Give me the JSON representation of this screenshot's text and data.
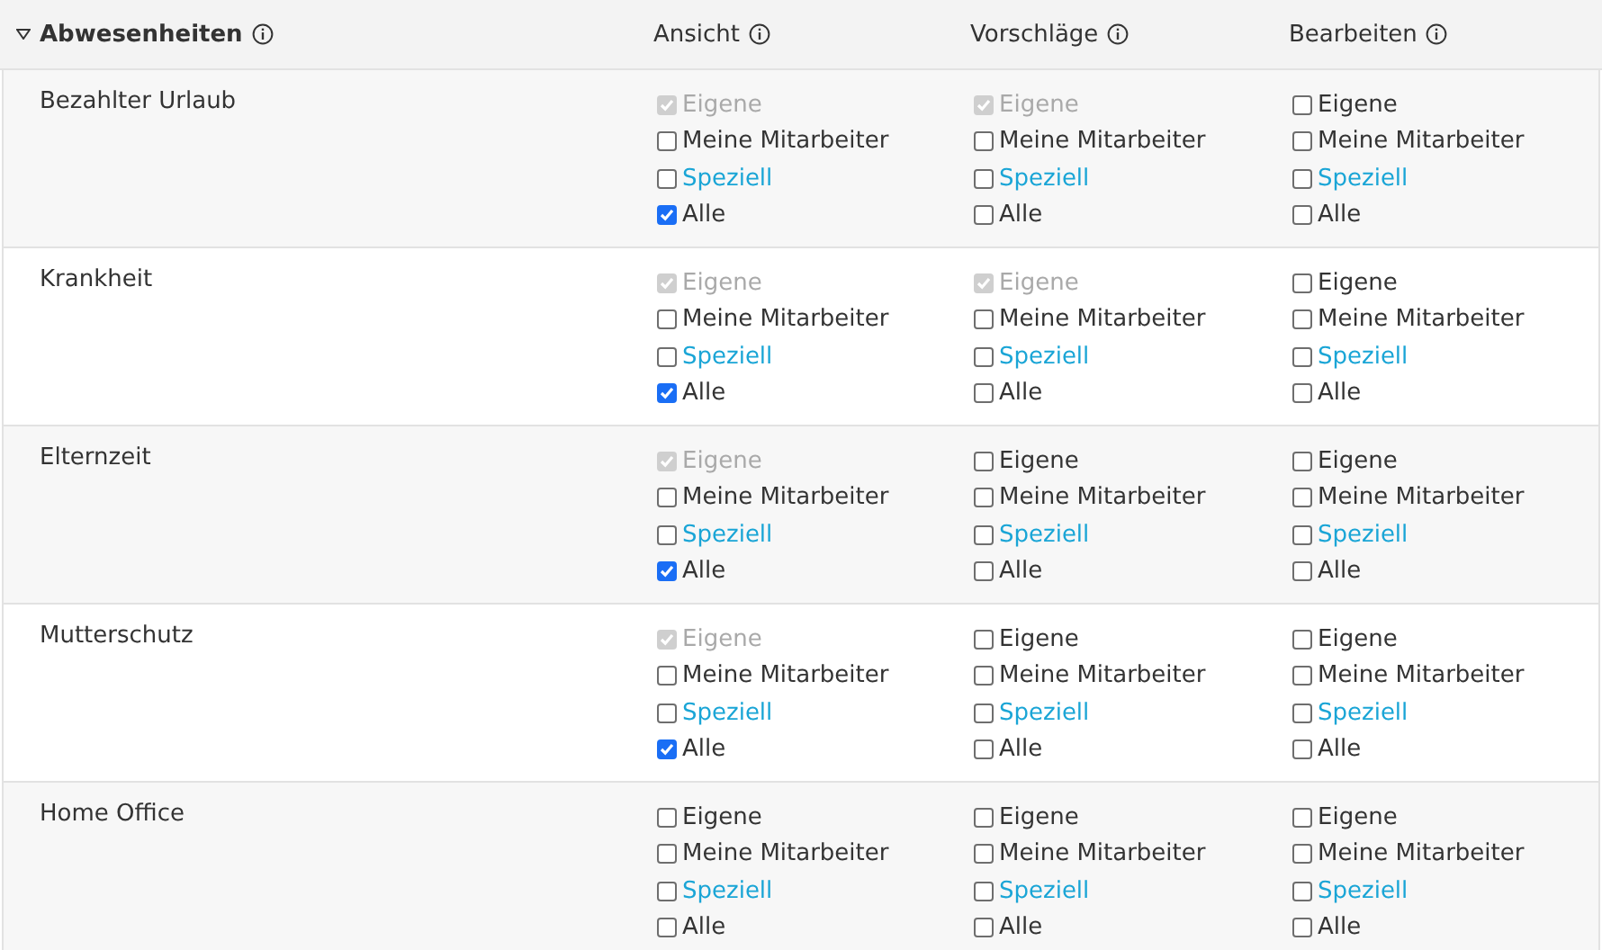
{
  "section": {
    "title": "Abwesenheiten",
    "expanded": true
  },
  "columns": [
    {
      "label": "Ansicht"
    },
    {
      "label": "Vorschläge"
    },
    {
      "label": "Bearbeiten"
    }
  ],
  "rows": [
    {
      "name": "Bezahlter Urlaub",
      "groups": [
        [
          {
            "label": "Eigene",
            "kind": "text",
            "checked": true,
            "disabled": true
          },
          {
            "label": "Meine Mitarbeiter",
            "kind": "text",
            "checked": false,
            "disabled": false
          },
          {
            "label": "Speziell",
            "kind": "link",
            "checked": false,
            "disabled": false
          },
          {
            "label": "Alle",
            "kind": "text",
            "checked": true,
            "disabled": false
          }
        ],
        [
          {
            "label": "Eigene",
            "kind": "text",
            "checked": true,
            "disabled": true
          },
          {
            "label": "Meine Mitarbeiter",
            "kind": "text",
            "checked": false,
            "disabled": false
          },
          {
            "label": "Speziell",
            "kind": "link",
            "checked": false,
            "disabled": false
          },
          {
            "label": "Alle",
            "kind": "text",
            "checked": false,
            "disabled": false
          }
        ],
        [
          {
            "label": "Eigene",
            "kind": "text",
            "checked": false,
            "disabled": false
          },
          {
            "label": "Meine Mitarbeiter",
            "kind": "text",
            "checked": false,
            "disabled": false
          },
          {
            "label": "Speziell",
            "kind": "link",
            "checked": false,
            "disabled": false
          },
          {
            "label": "Alle",
            "kind": "text",
            "checked": false,
            "disabled": false
          }
        ]
      ]
    },
    {
      "name": "Krankheit",
      "groups": [
        [
          {
            "label": "Eigene",
            "kind": "text",
            "checked": true,
            "disabled": true
          },
          {
            "label": "Meine Mitarbeiter",
            "kind": "text",
            "checked": false,
            "disabled": false
          },
          {
            "label": "Speziell",
            "kind": "link",
            "checked": false,
            "disabled": false
          },
          {
            "label": "Alle",
            "kind": "text",
            "checked": true,
            "disabled": false
          }
        ],
        [
          {
            "label": "Eigene",
            "kind": "text",
            "checked": true,
            "disabled": true
          },
          {
            "label": "Meine Mitarbeiter",
            "kind": "text",
            "checked": false,
            "disabled": false
          },
          {
            "label": "Speziell",
            "kind": "link",
            "checked": false,
            "disabled": false
          },
          {
            "label": "Alle",
            "kind": "text",
            "checked": false,
            "disabled": false
          }
        ],
        [
          {
            "label": "Eigene",
            "kind": "text",
            "checked": false,
            "disabled": false
          },
          {
            "label": "Meine Mitarbeiter",
            "kind": "text",
            "checked": false,
            "disabled": false
          },
          {
            "label": "Speziell",
            "kind": "link",
            "checked": false,
            "disabled": false
          },
          {
            "label": "Alle",
            "kind": "text",
            "checked": false,
            "disabled": false
          }
        ]
      ]
    },
    {
      "name": "Elternzeit",
      "groups": [
        [
          {
            "label": "Eigene",
            "kind": "text",
            "checked": true,
            "disabled": true
          },
          {
            "label": "Meine Mitarbeiter",
            "kind": "text",
            "checked": false,
            "disabled": false
          },
          {
            "label": "Speziell",
            "kind": "link",
            "checked": false,
            "disabled": false
          },
          {
            "label": "Alle",
            "kind": "text",
            "checked": true,
            "disabled": false
          }
        ],
        [
          {
            "label": "Eigene",
            "kind": "text",
            "checked": false,
            "disabled": false
          },
          {
            "label": "Meine Mitarbeiter",
            "kind": "text",
            "checked": false,
            "disabled": false
          },
          {
            "label": "Speziell",
            "kind": "link",
            "checked": false,
            "disabled": false
          },
          {
            "label": "Alle",
            "kind": "text",
            "checked": false,
            "disabled": false
          }
        ],
        [
          {
            "label": "Eigene",
            "kind": "text",
            "checked": false,
            "disabled": false
          },
          {
            "label": "Meine Mitarbeiter",
            "kind": "text",
            "checked": false,
            "disabled": false
          },
          {
            "label": "Speziell",
            "kind": "link",
            "checked": false,
            "disabled": false
          },
          {
            "label": "Alle",
            "kind": "text",
            "checked": false,
            "disabled": false
          }
        ]
      ]
    },
    {
      "name": "Mutterschutz",
      "groups": [
        [
          {
            "label": "Eigene",
            "kind": "text",
            "checked": true,
            "disabled": true
          },
          {
            "label": "Meine Mitarbeiter",
            "kind": "text",
            "checked": false,
            "disabled": false
          },
          {
            "label": "Speziell",
            "kind": "link",
            "checked": false,
            "disabled": false
          },
          {
            "label": "Alle",
            "kind": "text",
            "checked": true,
            "disabled": false
          }
        ],
        [
          {
            "label": "Eigene",
            "kind": "text",
            "checked": false,
            "disabled": false
          },
          {
            "label": "Meine Mitarbeiter",
            "kind": "text",
            "checked": false,
            "disabled": false
          },
          {
            "label": "Speziell",
            "kind": "link",
            "checked": false,
            "disabled": false
          },
          {
            "label": "Alle",
            "kind": "text",
            "checked": false,
            "disabled": false
          }
        ],
        [
          {
            "label": "Eigene",
            "kind": "text",
            "checked": false,
            "disabled": false
          },
          {
            "label": "Meine Mitarbeiter",
            "kind": "text",
            "checked": false,
            "disabled": false
          },
          {
            "label": "Speziell",
            "kind": "link",
            "checked": false,
            "disabled": false
          },
          {
            "label": "Alle",
            "kind": "text",
            "checked": false,
            "disabled": false
          }
        ]
      ]
    },
    {
      "name": "Home Office",
      "groups": [
        [
          {
            "label": "Eigene",
            "kind": "text",
            "checked": false,
            "disabled": false
          },
          {
            "label": "Meine Mitarbeiter",
            "kind": "text",
            "checked": false,
            "disabled": false
          },
          {
            "label": "Speziell",
            "kind": "link",
            "checked": false,
            "disabled": false
          },
          {
            "label": "Alle",
            "kind": "text",
            "checked": false,
            "disabled": false
          }
        ],
        [
          {
            "label": "Eigene",
            "kind": "text",
            "checked": false,
            "disabled": false
          },
          {
            "label": "Meine Mitarbeiter",
            "kind": "text",
            "checked": false,
            "disabled": false
          },
          {
            "label": "Speziell",
            "kind": "link",
            "checked": false,
            "disabled": false
          },
          {
            "label": "Alle",
            "kind": "text",
            "checked": false,
            "disabled": false
          }
        ],
        [
          {
            "label": "Eigene",
            "kind": "text",
            "checked": false,
            "disabled": false
          },
          {
            "label": "Meine Mitarbeiter",
            "kind": "text",
            "checked": false,
            "disabled": false
          },
          {
            "label": "Speziell",
            "kind": "link",
            "checked": false,
            "disabled": false
          },
          {
            "label": "Alle",
            "kind": "text",
            "checked": false,
            "disabled": false
          }
        ]
      ]
    }
  ]
}
